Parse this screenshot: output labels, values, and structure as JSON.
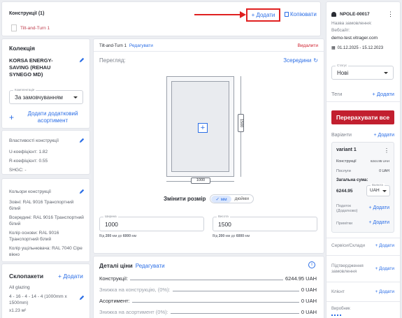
{
  "topbar": {
    "title": "Конструкції (1)",
    "item": "Tilt-and-Turn 1",
    "add_label": "+ Додати",
    "copy_label": "Копіювати"
  },
  "collection": {
    "heading": "Колекція",
    "name": "KORSA ENERGY-SAVING (REHAU SYNEGO MD)",
    "complect_label": "Комплектація",
    "complect_value": "За замовчуванням",
    "add_assortment": "Додати додатковий асортимент"
  },
  "properties": {
    "heading": "Властивості конструкції",
    "u": "U-коефіцієнт: 1.82",
    "r": "R-коефіцієнт: 0.55",
    "shgc": "SHGC: -"
  },
  "colors": {
    "heading": "Кольори конструкції",
    "outside": "Зовні: RAL 9016 Транспортний білий",
    "inside": "Всередині: RAL 9016 Транспортний білий",
    "base": "Колір основи: RAL 9016 Транспортний білий",
    "seal": "Колір ущільнювача: RAL 7040 Сіре вікно"
  },
  "glass": {
    "heading": "Склопакети",
    "add": "+ Додати",
    "all": "All glazing",
    "formula": "4 - 16 - 4 - 14 - 4 (1000mm x 1500mm)",
    "area": "x1.23 м²"
  },
  "config": {
    "product": "Tilt-and-Turn 1",
    "edit": "Редагувати",
    "delete": "Видалити",
    "view_label": "Перегляд:",
    "view_value": "Зсередини",
    "dim_width": "1000",
    "dim_height": "1500",
    "resize_label": "Змінити розмір",
    "unit_mm": "мм",
    "unit_in": "дюйми",
    "width_label": "Ширина",
    "width_value": "1000",
    "width_hint_pre": "Від ",
    "width_min": "200",
    "width_mid": " мм до ",
    "width_max": "6000",
    "width_hint_post": " мм",
    "height_label": "Висота",
    "height_value": "1500",
    "height_min": "200",
    "height_max": "6000"
  },
  "price": {
    "heading": "Деталі ціни",
    "edit": "Редагувати",
    "rows": [
      {
        "label": "Конструкції:",
        "value": "6244.95 UAH"
      },
      {
        "label": "Знижка на конструкцію, (0%):",
        "value": "0 UAH"
      },
      {
        "label": "Асортимент:",
        "value": "0 UAH"
      },
      {
        "label": "Знижка на асортимент (0%):",
        "value": "0 UAH"
      }
    ]
  },
  "order": {
    "id": "NPOLE-00017",
    "name_label": "Назва замовлення:",
    "name_value": "Вебсайт:",
    "website": "demo-test.vitrager.com",
    "dates": "01.12.2025 - 15.12.2023",
    "status_label": "Статус",
    "status_value": "Нові",
    "tags": "Теги",
    "add": "+ Додати",
    "recalc": "Перерахувати все",
    "variants": "Варіанти",
    "variant_name": "variant 1",
    "v_constructions": "Конструкції",
    "v_constructions_val": "6244.95 UAH",
    "v_services": "Послуги",
    "v_services_val": "0 UAH",
    "v_total_label": "Загальна сума:",
    "v_total_val": "6244.95",
    "currency_label": "Валюта",
    "currency": "UAH",
    "tax": "Податок (Додатково)",
    "notes": "Примітки",
    "services": "Сервіси/Склади",
    "confirm": "Підтвердження замовлення",
    "client": "Клієнт",
    "manufacturer": "Виробник"
  }
}
